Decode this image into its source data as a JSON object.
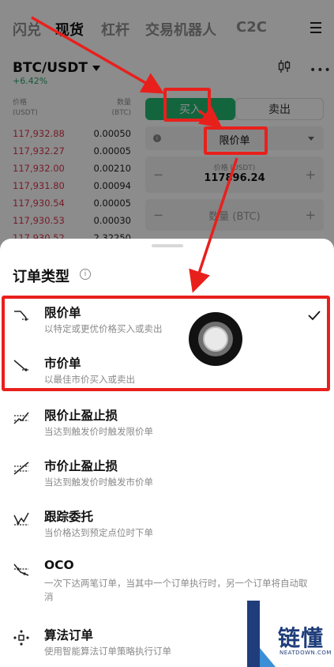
{
  "nav": {
    "tabs": [
      "闪兑",
      "现货",
      "杠杆",
      "交易机器人",
      "C2C"
    ],
    "active_index": 1
  },
  "market": {
    "pair": "BTC/USDT",
    "change": "+6.42%"
  },
  "orderbook": {
    "price_header": [
      "价格",
      "(USDT)"
    ],
    "qty_header": [
      "数量",
      "(BTC)"
    ],
    "rows": [
      {
        "price": "117,932.88",
        "qty": "0.00050"
      },
      {
        "price": "117,932.27",
        "qty": "0.00005"
      },
      {
        "price": "117,932.00",
        "qty": "0.00210"
      },
      {
        "price": "117,931.80",
        "qty": "0.00094"
      },
      {
        "price": "117,930.54",
        "qty": "0.00005"
      },
      {
        "price": "117,930.53",
        "qty": "0.00030"
      },
      {
        "price": "117,930.52",
        "qty": "2.32250"
      }
    ]
  },
  "trade_form": {
    "buy_label": "买入",
    "sell_label": "卖出",
    "order_type": "限价单",
    "price_label": "价格 (USDT)",
    "price_value": "117896.24",
    "qty_placeholder": "数量 (BTC)",
    "minus": "−",
    "plus": "+"
  },
  "sheet": {
    "title": "订单类型",
    "options": [
      {
        "title": "限价单",
        "desc": "以特定或更优价格买入或卖出",
        "icon": "limit-order-icon",
        "selected": true
      },
      {
        "title": "市价单",
        "desc": "以最佳市价买入或卖出",
        "icon": "market-order-icon",
        "selected": false
      },
      {
        "title": "限价止盈止损",
        "desc": "当达到触发价时触发限价单",
        "icon": "limit-tpsl-icon",
        "selected": false
      },
      {
        "title": "市价止盈止损",
        "desc": "当达到触发价时触发市价单",
        "icon": "market-tpsl-icon",
        "selected": false
      },
      {
        "title": "跟踪委托",
        "desc": "当价格达到预定点位时下单",
        "icon": "trailing-order-icon",
        "selected": false
      },
      {
        "title": "OCO",
        "desc": "一次下达两笔订单，当其中一个订单执行时，另一个订单将自动取消",
        "icon": "oco-icon",
        "selected": false
      },
      {
        "title": "算法订单",
        "desc": "使用智能算法订单策略执行订单",
        "icon": "algo-order-icon",
        "selected": false
      }
    ]
  },
  "watermark": {
    "text": "链懂",
    "sub": "NEATDOWN.COM"
  },
  "colors": {
    "buy": "#24b872",
    "ask_price": "#d9364d",
    "annotation": "#e8201c",
    "watermark": "#1f3d7a"
  }
}
